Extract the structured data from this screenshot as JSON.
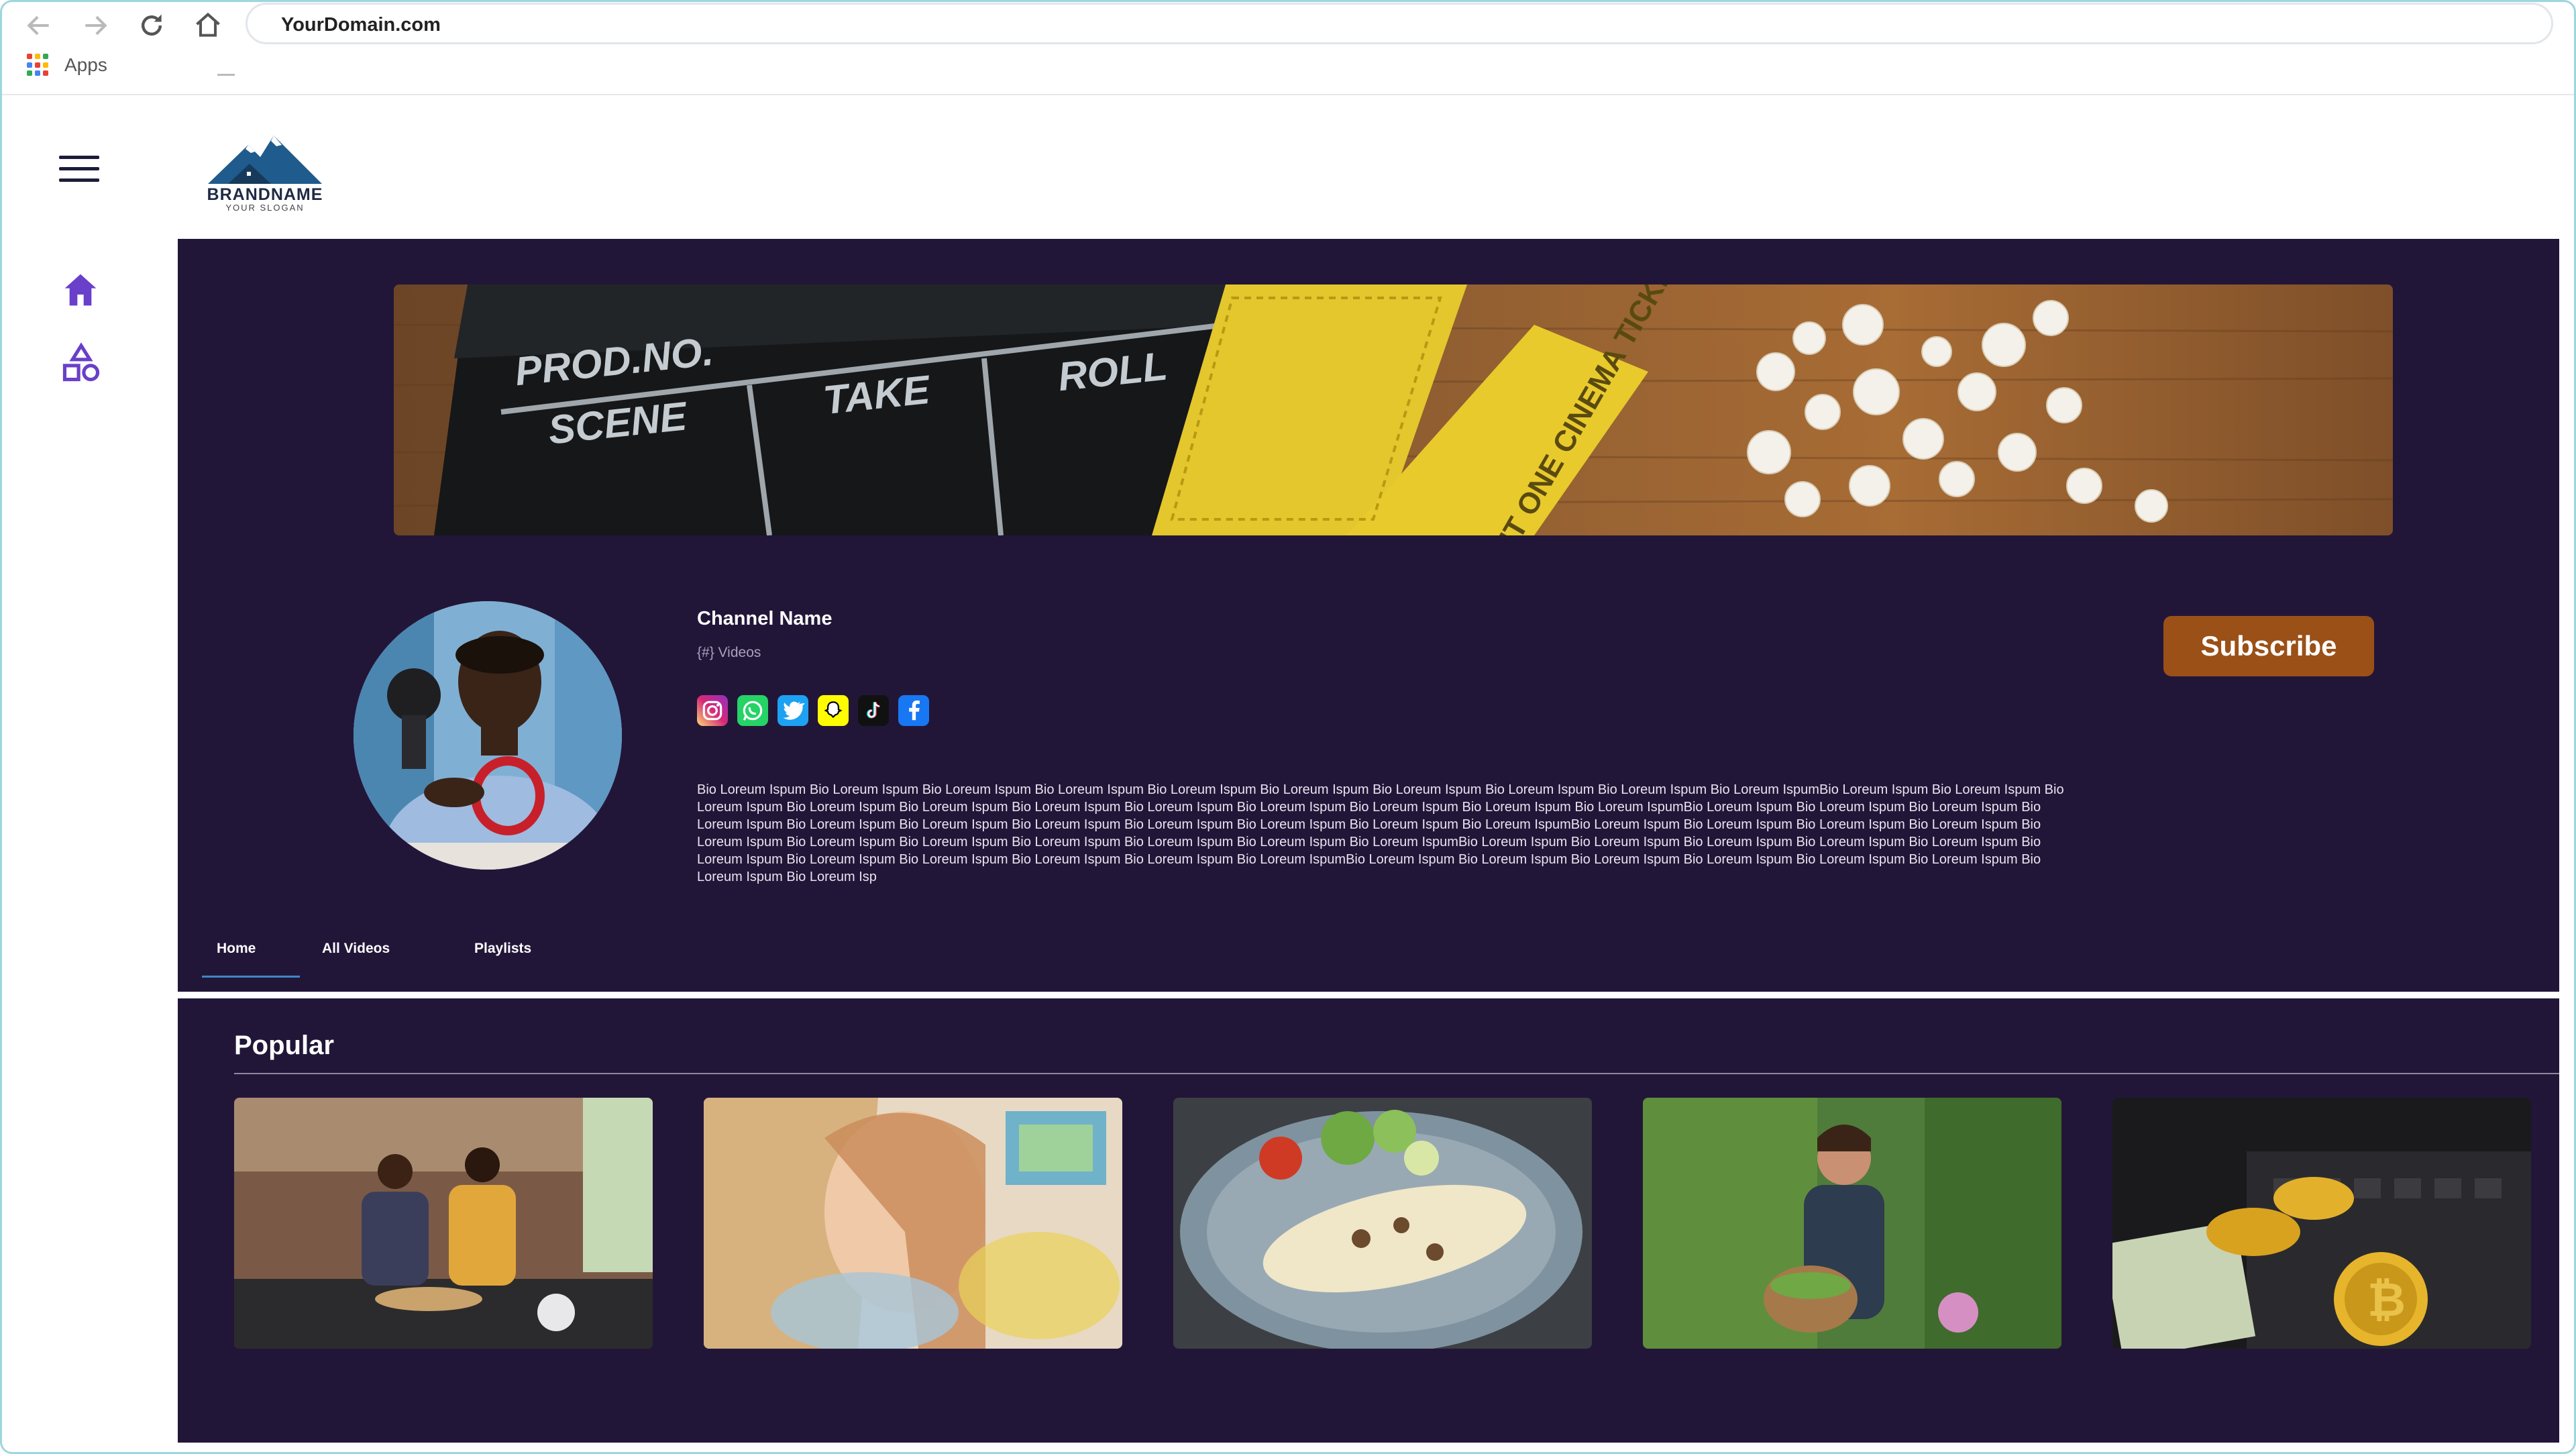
{
  "browser": {
    "url": "YourDomain.com",
    "bookmarks_apps_label": "Apps",
    "icons": [
      "back-arrow-icon",
      "forward-arrow-icon",
      "reload-icon",
      "home-icon"
    ]
  },
  "rail": {
    "icons": [
      "hamburger-menu-icon",
      "home-icon",
      "shapes-icon"
    ],
    "accent_color": "#6a3fc9"
  },
  "brand": {
    "name": "BRANDNAME",
    "slogan": "YOUR SLOGAN"
  },
  "banner": {
    "clapper_labels": [
      "PROD.NO.",
      "SCENE",
      "TAKE",
      "ROLL"
    ],
    "ticket_text": "ADMIT ONE CINEMA TICKET"
  },
  "channel": {
    "name": "Channel Name",
    "video_count": "{#} Videos",
    "socials": [
      "instagram-icon",
      "whatsapp-icon",
      "twitter-icon",
      "snapchat-icon",
      "tiktok-icon",
      "facebook-icon"
    ],
    "subscribe_label": "Subscribe",
    "subscribe_color": "#9b5018",
    "bio": "Bio Loreum Ispum Bio Loreum Ispum Bio Loreum Ispum Bio Loreum Ispum Bio Loreum Ispum Bio Loreum Ispum Bio Loreum Ispum Bio Loreum Ispum Bio Loreum Ispum  Bio Loreum IspumBio Loreum Ispum Bio Loreum Ispum Bio Loreum Ispum Bio Loreum Ispum Bio Loreum Ispum Bio Loreum Ispum Bio Loreum Ispum Bio Loreum Ispum Bio Loreum Ispum Bio Loreum Ispum  Bio Loreum IspumBio Loreum Ispum  Bio Loreum Ispum Bio Loreum Ispum Bio Loreum Ispum Bio Loreum Ispum Bio Loreum Ispum Bio Loreum Ispum Bio Loreum Ispum Bio Loreum Ispum Bio Loreum Ispum  Bio Loreum IspumBio Loreum Ispum   Bio Loreum Ispum Bio Loreum Ispum Bio Loreum Ispum Bio Loreum Ispum Bio Loreum Ispum Bio Loreum Ispum Bio Loreum Ispum Bio Loreum Ispum Bio Loreum Ispum  Bio Loreum IspumBio Loreum Ispum   Bio Loreum Ispum Bio Loreum Ispum Bio Loreum Ispum Bio Loreum Ispum Bio Loreum Ispum Bio Loreum Ispum Bio Loreum Ispum Bio Loreum Ispum Bio Loreum Ispum  Bio Loreum IspumBio Loreum Ispum   Bio Loreum Ispum Bio Loreum Ispum Bio Loreum Ispum Bio Loreum Ispum Bio Loreum Ispum Bio Loreum Ispum Bio Loreum Isp"
  },
  "tabs": [
    {
      "label": "Home",
      "active": true
    },
    {
      "label": "All Videos",
      "active": false
    },
    {
      "label": "Playlists",
      "active": false
    }
  ],
  "popular": {
    "title": "Popular",
    "thumbnails": [
      "cooking-couple-thumbnail",
      "painting-thumbnail",
      "omelette-salad-thumbnail",
      "gardening-woman-thumbnail",
      "crypto-coins-thumbnail"
    ]
  }
}
